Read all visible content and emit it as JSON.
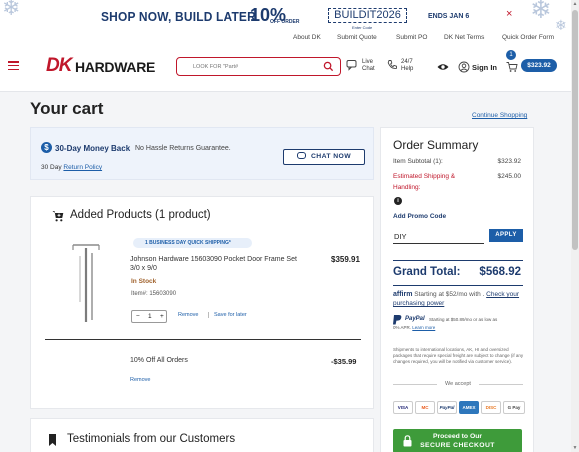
{
  "promo": {
    "headline": "SHOP NOW, BUILD LATER",
    "discount": "10%",
    "off_label": "OFF ORDER",
    "code": "BUILDIT2026",
    "code_caption": "Enter Code",
    "ends": "ENDS JAN 6",
    "close": "×"
  },
  "top_links": [
    "About DK",
    "Submit Quote",
    "Submit PO",
    "DK Net Terms",
    "Quick Order Form"
  ],
  "header": {
    "logo_dk": "DK",
    "logo_text": "HARDWARE",
    "search_placeholder": "LOOK FOR \"Part#",
    "live_chat": [
      "Live",
      "Chat"
    ],
    "help": [
      "24/7",
      "Help"
    ],
    "sign_in": "Sign In",
    "cart_count": "1",
    "cart_total": "$323.92"
  },
  "page": {
    "title": "Your cart",
    "continue_shopping": "Continue Shopping"
  },
  "guarantee": {
    "title": "30-Day Money Back",
    "subtitle": "No Hassle Returns Guarantee.",
    "policy_prefix": "30 Day",
    "policy_link": "Return Policy",
    "chat_button": "CHAT NOW"
  },
  "products": {
    "title": "Added Products (1 product)",
    "shipping_badge": "1 BUSINESS DAY QUICK SHIPPING*",
    "item": {
      "name": "Johnson Hardware 15603090 Pocket Door Frame Set 3/0 x 9/0",
      "price": "$359.91",
      "stock": "In Stock",
      "item_no": "Item#: 15603090",
      "qty_minus": "−",
      "qty": "1",
      "qty_plus": "+",
      "remove": "Remove",
      "save_for_later": "Save for later"
    },
    "discount": {
      "label": "10% Off All Orders",
      "amount": "-$35.99",
      "remove": "Remove"
    }
  },
  "testimonials": {
    "title": "Testimonials from our Customers"
  },
  "summary": {
    "title": "Order Summary",
    "subtotal_label": "Item Subtotal (1):",
    "subtotal_value": "$323.92",
    "shipping_label_1": "Estimated Shipping &",
    "shipping_label_2": "Handling:",
    "shipping_value": "$245.00",
    "info": "i",
    "promo_link": "Add Promo Code",
    "promo_value": "DIY",
    "apply": "APPLY",
    "grand_label": "Grand Total:",
    "grand_value": "$568.92",
    "affirm_brand": "affirm",
    "affirm_text": "Starting at $52/mo with .",
    "affirm_link": "Check your purchasing power",
    "paypal_brand": "PayPal",
    "paypal_text": "Starting at $50.89/mo or as low as",
    "paypal_text2": "0% APR.",
    "paypal_link": "Learn more",
    "fine_print": "Shipments to international locations, AK, HI and oversized packages that require special freight are subject to change (if any changes required, you will be notified via customer service).",
    "we_accept": "We accept",
    "cards": [
      "VISA",
      "MC",
      "PayPal",
      "AMEX",
      "DISC",
      "G Pay"
    ],
    "checkout_line1": "Proceed to Our",
    "checkout_line2": "SECURE CHECKOUT"
  },
  "colors": {
    "brand_red": "#c0172b",
    "brand_blue": "#1d5ea8",
    "navy": "#1d3b6e",
    "checkout_green": "#3e9b3a"
  }
}
